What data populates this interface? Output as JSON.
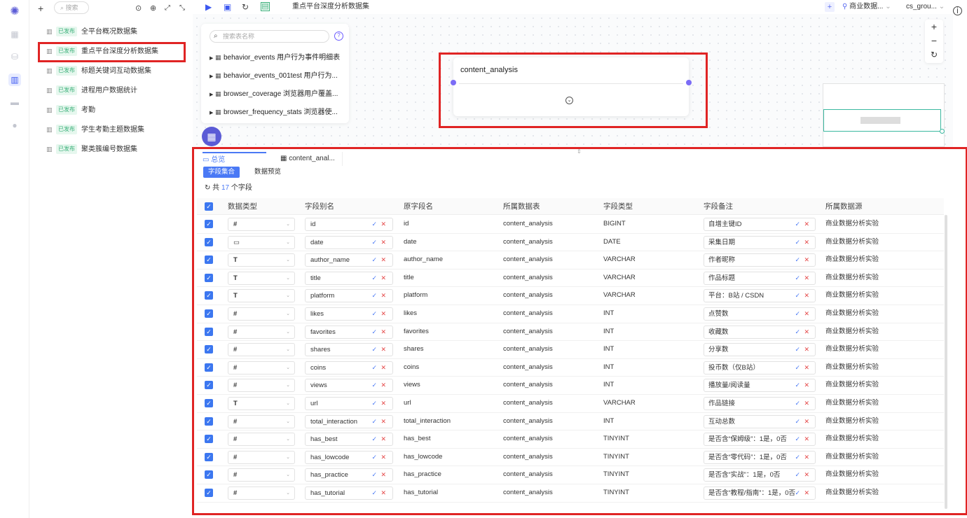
{
  "rail": {
    "logo_icon": "cluster-logo-icon",
    "items": [
      "apps-icon",
      "database-icon",
      "dataset-icon",
      "folder-icon",
      "monitor-icon"
    ],
    "active_index": 2
  },
  "left": {
    "add_label": "+",
    "search_placeholder": "搜索",
    "datasets": [
      {
        "status": "已发布",
        "name": "全平台概况数据集"
      },
      {
        "status": "已发布",
        "name": "重点平台深度分析数据集"
      },
      {
        "status": "已发布",
        "name": "标题关键词互动数据集"
      },
      {
        "status": "已发布",
        "name": "进程用户数据统计"
      },
      {
        "status": "已发布",
        "name": "考勤"
      },
      {
        "status": "已发布",
        "name": "学生考勤主题数据集"
      },
      {
        "status": "已发布",
        "name": "聚类簇编号数据集"
      }
    ]
  },
  "topbar": {
    "title": "重点平台深度分析数据集",
    "datasource": "商业数据...",
    "user": "cs_grou..."
  },
  "tables_panel": {
    "search_placeholder": "搜索表名称",
    "help": "?",
    "tables": [
      {
        "name": "behavior_events",
        "desc": "用户行为事件明细表"
      },
      {
        "name": "behavior_events_001test",
        "desc": "用户行为..."
      },
      {
        "name": "browser_coverage",
        "desc": "浏览器用户覆盖..."
      },
      {
        "name": "browser_frequency_stats",
        "desc": "浏览器使..."
      }
    ]
  },
  "node": {
    "title": "content_analysis"
  },
  "zoom": {
    "in": "+",
    "out": "−",
    "reset": "↻"
  },
  "tabs": {
    "overview": "总览",
    "table": "content_anal..."
  },
  "subtabs": {
    "fields": "字段集合",
    "preview": "数据预览"
  },
  "count": {
    "prefix": "共",
    "number": "17",
    "suffix": "个字段"
  },
  "columns": [
    "数据类型",
    "字段别名",
    "原字段名",
    "所属数据表",
    "字段类型",
    "字段备注",
    "所属数据源"
  ],
  "rows": [
    {
      "icon": "#",
      "alias": "id",
      "orig": "id",
      "table": "content_analysis",
      "type": "BIGINT",
      "note": "自增主键ID",
      "source": "商业数据分析实验"
    },
    {
      "icon": "▭",
      "alias": "date",
      "orig": "date",
      "table": "content_analysis",
      "type": "DATE",
      "note": "采集日期",
      "source": "商业数据分析实验"
    },
    {
      "icon": "T",
      "alias": "author_name",
      "orig": "author_name",
      "table": "content_analysis",
      "type": "VARCHAR",
      "note": "作者昵称",
      "source": "商业数据分析实验"
    },
    {
      "icon": "T",
      "alias": "title",
      "orig": "title",
      "table": "content_analysis",
      "type": "VARCHAR",
      "note": "作品标题",
      "source": "商业数据分析实验"
    },
    {
      "icon": "T",
      "alias": "platform",
      "orig": "platform",
      "table": "content_analysis",
      "type": "VARCHAR",
      "note": "平台：B站 / CSDN",
      "source": "商业数据分析实验"
    },
    {
      "icon": "#",
      "alias": "likes",
      "orig": "likes",
      "table": "content_analysis",
      "type": "INT",
      "note": "点赞数",
      "source": "商业数据分析实验"
    },
    {
      "icon": "#",
      "alias": "favorites",
      "orig": "favorites",
      "table": "content_analysis",
      "type": "INT",
      "note": "收藏数",
      "source": "商业数据分析实验"
    },
    {
      "icon": "#",
      "alias": "shares",
      "orig": "shares",
      "table": "content_analysis",
      "type": "INT",
      "note": "分享数",
      "source": "商业数据分析实验"
    },
    {
      "icon": "#",
      "alias": "coins",
      "orig": "coins",
      "table": "content_analysis",
      "type": "INT",
      "note": "投币数（仅B站）",
      "source": "商业数据分析实验"
    },
    {
      "icon": "#",
      "alias": "views",
      "orig": "views",
      "table": "content_analysis",
      "type": "INT",
      "note": "播放量/阅读量",
      "source": "商业数据分析实验"
    },
    {
      "icon": "T",
      "alias": "url",
      "orig": "url",
      "table": "content_analysis",
      "type": "VARCHAR",
      "note": "作品链接",
      "source": "商业数据分析实验"
    },
    {
      "icon": "#",
      "alias": "total_interaction",
      "orig": "total_interaction",
      "table": "content_analysis",
      "type": "INT",
      "note": "互动总数",
      "source": "商业数据分析实验"
    },
    {
      "icon": "#",
      "alias": "has_best",
      "orig": "has_best",
      "table": "content_analysis",
      "type": "TINYINT",
      "note": "是否含“保姆级”：1是，0否",
      "source": "商业数据分析实验"
    },
    {
      "icon": "#",
      "alias": "has_lowcode",
      "orig": "has_lowcode",
      "table": "content_analysis",
      "type": "TINYINT",
      "note": "是否含“零代码”：1是，0否",
      "source": "商业数据分析实验"
    },
    {
      "icon": "#",
      "alias": "has_practice",
      "orig": "has_practice",
      "table": "content_analysis",
      "type": "TINYINT",
      "note": "是否含“实战”：1是，0否",
      "source": "商业数据分析实验"
    },
    {
      "icon": "#",
      "alias": "has_tutorial",
      "orig": "has_tutorial",
      "table": "content_analysis",
      "type": "TINYINT",
      "note": "是否含“教程/指南”：1是，0否",
      "source": "商业数据分析实验"
    }
  ]
}
